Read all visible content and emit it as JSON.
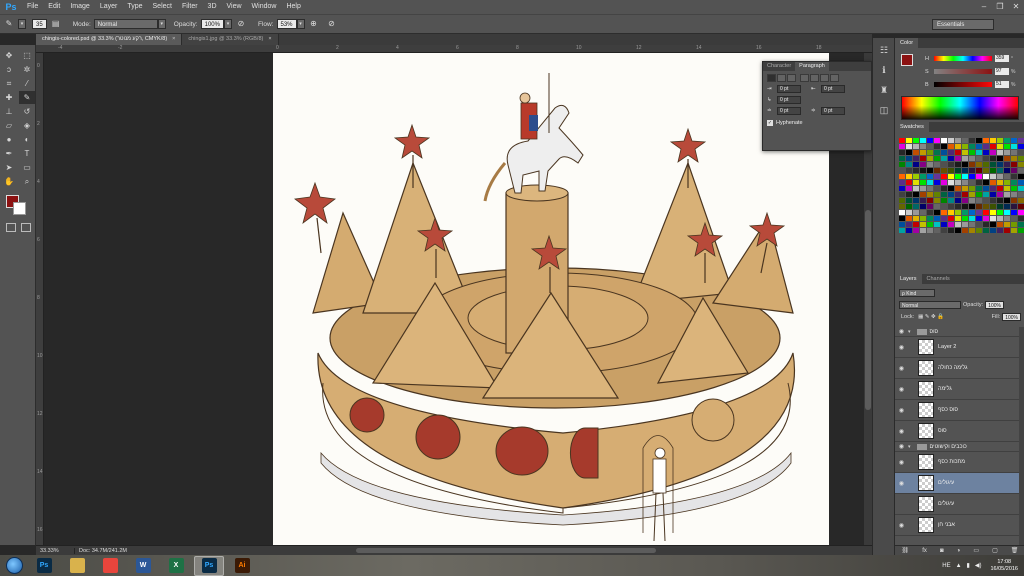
{
  "app": {
    "logo": "Ps",
    "menu": [
      "File",
      "Edit",
      "Image",
      "Layer",
      "Type",
      "Select",
      "Filter",
      "3D",
      "View",
      "Window",
      "Help"
    ],
    "window_controls": [
      "–",
      "❐",
      "✕"
    ]
  },
  "options_bar": {
    "brush_size": "35",
    "mode_label": "Mode:",
    "mode_value": "Normal",
    "opacity_label": "Opacity:",
    "opacity_value": "100%",
    "flow_label": "Flow:",
    "flow_value": "53%",
    "workspace": "Essentials"
  },
  "tabs": [
    {
      "label": "chingis-colored.psd @ 33.3% (רקע מנוטר, CMYK/8)",
      "close": "×",
      "active": true
    },
    {
      "label": "chingis1.jpg @ 33.3% (RGB/8)",
      "close": "×",
      "active": false
    }
  ],
  "ruler": {
    "top": [
      "-4",
      "-2",
      "0",
      "2",
      "4",
      "6",
      "8",
      "10",
      "12",
      "14",
      "16",
      "18"
    ],
    "left": [
      "0",
      "2",
      "4",
      "6",
      "8",
      "10",
      "12",
      "14",
      "16"
    ]
  },
  "status": {
    "zoom": "33.33%",
    "doc": "Doc: 34.7M/241.2M"
  },
  "char_panel": {
    "tabs": [
      "Character",
      "Paragraph"
    ],
    "fields": [
      "0 pt",
      "0 pt",
      "0 pt",
      "0 pt",
      "0 pt"
    ],
    "hyphenate_label": "Hyphenate",
    "hyphenate_checked": true
  },
  "color_panel": {
    "tab": "Color",
    "h_label": "H",
    "h_value": "359",
    "h_unit": "°",
    "s_label": "S",
    "s_value": "97",
    "s_unit": "%",
    "b_label": "B",
    "b_value": "51",
    "b_unit": "%",
    "foreground": "#8b1111"
  },
  "swatches_panel": {
    "tab": "Swatches"
  },
  "layers_panel": {
    "tabs": [
      "Layers",
      "Channels"
    ],
    "filter_label": "ρ Kind",
    "blend_mode": "Normal",
    "opacity_label": "Opacity:",
    "opacity_value": "100%",
    "lock_label": "Lock:",
    "fill_label": "Fill:",
    "fill_value": "100%",
    "layers": [
      {
        "name": "סוס",
        "type": "group",
        "selected": false
      },
      {
        "name": "Layer 2",
        "type": "layer",
        "selected": false
      },
      {
        "name": "גלימה כחולה",
        "type": "layer",
        "selected": false
      },
      {
        "name": "גלימה",
        "type": "layer",
        "selected": false
      },
      {
        "name": "סוס כסף",
        "type": "layer",
        "selected": false
      },
      {
        "name": "סוס",
        "type": "layer",
        "selected": false
      },
      {
        "name": "כוכבים וקישוטים",
        "type": "group",
        "selected": false
      },
      {
        "name": "מתכות כסף",
        "type": "layer",
        "selected": false
      },
      {
        "name": "עיגולים",
        "type": "layer",
        "selected": true
      },
      {
        "name": "עיגולים",
        "type": "layer",
        "selected": false
      },
      {
        "name": "אבני חן",
        "type": "layer",
        "selected": false
      }
    ]
  },
  "taskbar": {
    "apps": [
      {
        "name": "Ps",
        "bg": "#0a2b45",
        "fg": "#31a8ff",
        "active": false
      },
      {
        "name": "",
        "bg": "#d9b24c",
        "fg": "#fff",
        "active": false
      },
      {
        "name": "",
        "bg": "#e8453c",
        "fg": "#fff",
        "active": false
      },
      {
        "name": "W",
        "bg": "#2b5797",
        "fg": "#fff",
        "active": false
      },
      {
        "name": "X",
        "bg": "#1e7145",
        "fg": "#fff",
        "active": false
      },
      {
        "name": "Ps",
        "bg": "#0a2b45",
        "fg": "#31a8ff",
        "active": true
      },
      {
        "name": "Ai",
        "bg": "#3b1a05",
        "fg": "#ff7c00",
        "active": false
      }
    ],
    "lang": "HE",
    "time": "17:08",
    "date": "16/05/2016"
  }
}
